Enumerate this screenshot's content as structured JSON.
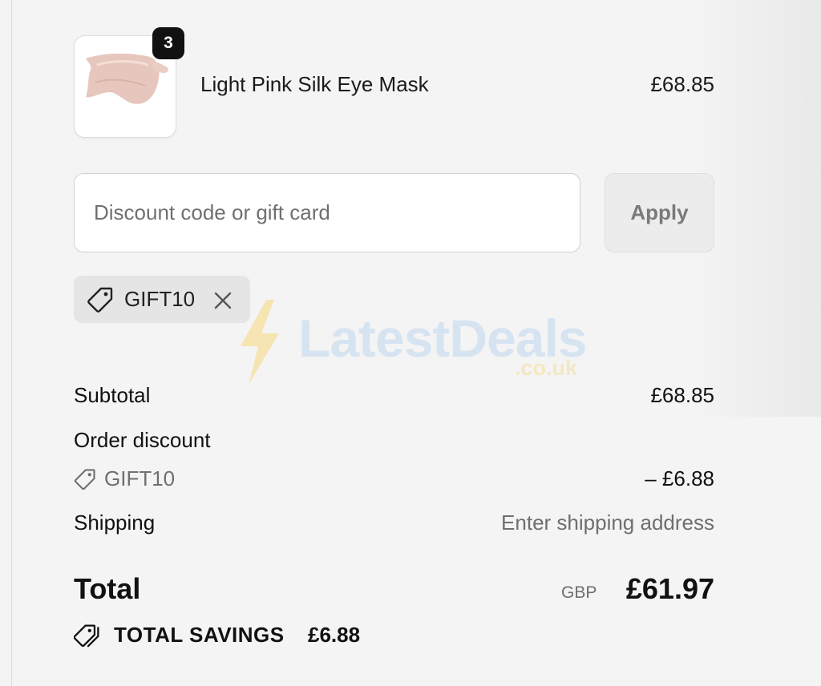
{
  "cart": {
    "item": {
      "name": "Light Pink Silk Eye Mask",
      "price": "£68.85",
      "quantity": "3",
      "image_icon": "eye-mask-thumbnail"
    }
  },
  "discount": {
    "placeholder": "Discount code or gift card",
    "value": "",
    "apply_label": "Apply",
    "applied_code": "GIFT10"
  },
  "watermark": {
    "text": "LatestDeals",
    "sub": ".co.uk"
  },
  "summary": {
    "subtotal_label": "Subtotal",
    "subtotal_value": "£68.85",
    "order_discount_label": "Order discount",
    "discount_code": "GIFT10",
    "discount_value": "– £6.88",
    "shipping_label": "Shipping",
    "shipping_value": "Enter shipping address",
    "total_label": "Total",
    "currency": "GBP",
    "total_value": "£61.97",
    "savings_label": "TOTAL SAVINGS",
    "savings_value": "£6.88"
  },
  "colors": {
    "background": "#f4f4f4",
    "text": "#111111",
    "muted": "#6e6e6e",
    "badge": "#111111"
  }
}
